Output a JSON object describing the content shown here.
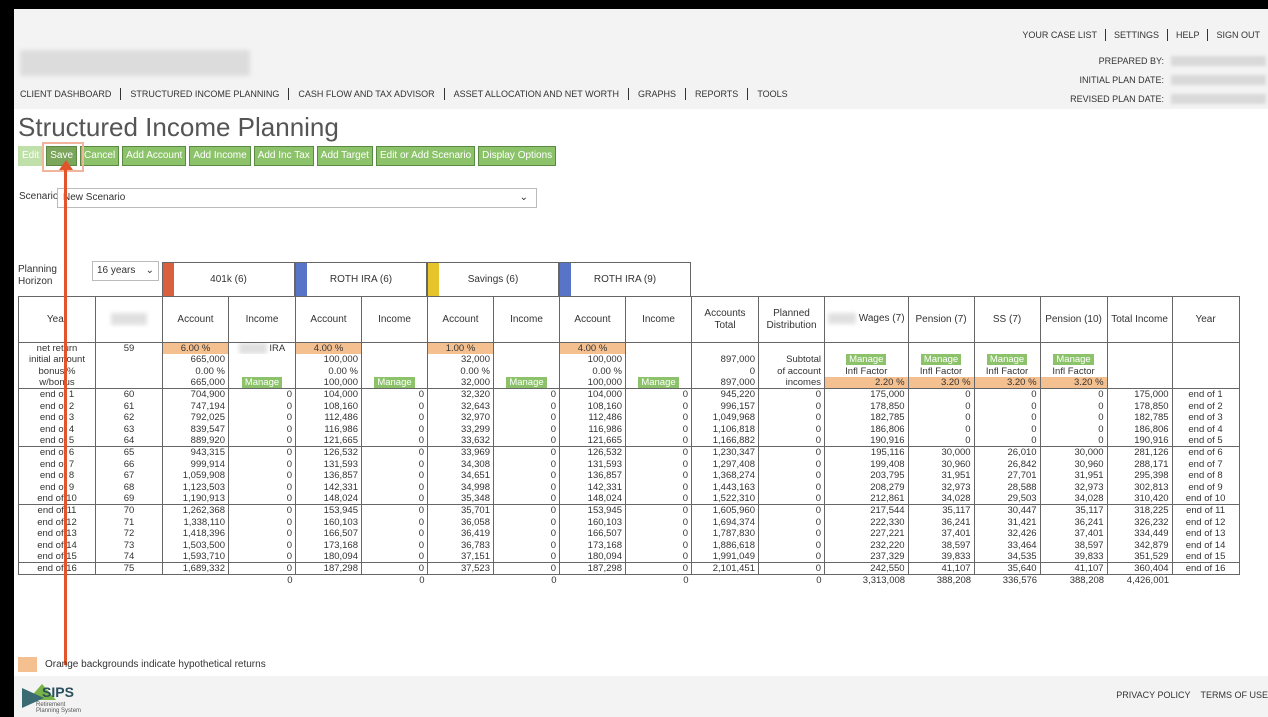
{
  "util_links": [
    "YOUR CASE LIST",
    "SETTINGS",
    "HELP",
    "SIGN OUT"
  ],
  "plan_info": {
    "prepared_by": "PREPARED BY:",
    "initial_plan_date": "INITIAL PLAN DATE:",
    "revised_plan_date": "REVISED PLAN DATE:"
  },
  "nav": [
    "CLIENT DASHBOARD",
    "STRUCTURED INCOME PLANNING",
    "CASH FLOW AND TAX ADVISOR",
    "ASSET ALLOCATION AND NET WORTH",
    "GRAPHS",
    "REPORTS",
    "TOOLS"
  ],
  "page_title": "Structured Income Planning",
  "toolbar": {
    "edit": "Edit",
    "save": "Save",
    "cancel": "Cancel",
    "add_account": "Add Account",
    "add_income": "Add Income",
    "add_inc_tax": "Add Inc Tax",
    "add_target": "Add Target",
    "edit_scenario": "Edit or Add Scenario",
    "display_options": "Display Options"
  },
  "scenario": {
    "label": "Scenario",
    "value": "New Scenario"
  },
  "planning_horizon": {
    "label_line1": "Planning",
    "label_line2": "Horizon",
    "value": "16 years"
  },
  "accounts": [
    {
      "name": "401k (6)",
      "color": "#d9603f"
    },
    {
      "name": "ROTH IRA (6)",
      "color": "#5874c9"
    },
    {
      "name": "Savings (6)",
      "color": "#e6c52b"
    },
    {
      "name": "ROTH IRA (9)",
      "color": "#5874c9"
    }
  ],
  "headers": {
    "year": "Year",
    "account": "Account",
    "income": "Income",
    "accounts_total": "Accounts Total",
    "planned_distribution": "Planned Distribution",
    "wages": "Wages (7)",
    "pension7": "Pension (7)",
    "ss": "SS (7)",
    "pension10": "Pension (10)",
    "total_income": "Total Income",
    "year_right": "Year"
  },
  "info_rows": {
    "labels": [
      "net return",
      "initial amount",
      "bonus %",
      "w/bonus"
    ],
    "age_first": "59",
    "a1": [
      "6.00 %",
      "665,000",
      "0.00 %",
      "665,000"
    ],
    "i1_ira": "IRA",
    "a2": [
      "4.00 %",
      "100,000",
      "0.00 %",
      "100,000"
    ],
    "a3": [
      "1.00 %",
      "32,000",
      "0.00 %",
      "32,000"
    ],
    "a4": [
      "4.00 %",
      "100,000",
      "0.00 %",
      "100,000"
    ],
    "accounts_total": [
      "",
      "897,000",
      "0",
      "897,000"
    ],
    "planned": [
      "",
      "Subtotal",
      "of account",
      "incomes"
    ],
    "manage": "Manage",
    "infl_factor": "Infl Factor",
    "wages_infl": "2.20 %",
    "p7_infl": "3.20 %",
    "ss_infl": "3.20 %",
    "p10_infl": "3.20 %"
  },
  "rows": [
    {
      "y": "end of 1",
      "age": "60",
      "a1": "704,900",
      "i1": "0",
      "a2": "104,000",
      "i2": "0",
      "a3": "32,320",
      "i3": "0",
      "a4": "104,000",
      "i4": "0",
      "tot": "945,220",
      "pd": "0",
      "w": "175,000",
      "p7": "0",
      "ss": "0",
      "p10": "0",
      "ti": "175,000"
    },
    {
      "y": "end of 2",
      "age": "61",
      "a1": "747,194",
      "i1": "0",
      "a2": "108,160",
      "i2": "0",
      "a3": "32,643",
      "i3": "0",
      "a4": "108,160",
      "i4": "0",
      "tot": "996,157",
      "pd": "0",
      "w": "178,850",
      "p7": "0",
      "ss": "0",
      "p10": "0",
      "ti": "178,850"
    },
    {
      "y": "end of 3",
      "age": "62",
      "a1": "792,025",
      "i1": "0",
      "a2": "112,486",
      "i2": "0",
      "a3": "32,970",
      "i3": "0",
      "a4": "112,486",
      "i4": "0",
      "tot": "1,049,968",
      "pd": "0",
      "w": "182,785",
      "p7": "0",
      "ss": "0",
      "p10": "0",
      "ti": "182,785"
    },
    {
      "y": "end of 4",
      "age": "63",
      "a1": "839,547",
      "i1": "0",
      "a2": "116,986",
      "i2": "0",
      "a3": "33,299",
      "i3": "0",
      "a4": "116,986",
      "i4": "0",
      "tot": "1,106,818",
      "pd": "0",
      "w": "186,806",
      "p7": "0",
      "ss": "0",
      "p10": "0",
      "ti": "186,806"
    },
    {
      "y": "end of 5",
      "age": "64",
      "a1": "889,920",
      "i1": "0",
      "a2": "121,665",
      "i2": "0",
      "a3": "33,632",
      "i3": "0",
      "a4": "121,665",
      "i4": "0",
      "tot": "1,166,882",
      "pd": "0",
      "w": "190,916",
      "p7": "0",
      "ss": "0",
      "p10": "0",
      "ti": "190,916"
    },
    {
      "y": "end of 6",
      "age": "65",
      "a1": "943,315",
      "i1": "0",
      "a2": "126,532",
      "i2": "0",
      "a3": "33,969",
      "i3": "0",
      "a4": "126,532",
      "i4": "0",
      "tot": "1,230,347",
      "pd": "0",
      "w": "195,116",
      "p7": "30,000",
      "ss": "26,010",
      "p10": "30,000",
      "ti": "281,126"
    },
    {
      "y": "end of 7",
      "age": "66",
      "a1": "999,914",
      "i1": "0",
      "a2": "131,593",
      "i2": "0",
      "a3": "34,308",
      "i3": "0",
      "a4": "131,593",
      "i4": "0",
      "tot": "1,297,408",
      "pd": "0",
      "w": "199,408",
      "p7": "30,960",
      "ss": "26,842",
      "p10": "30,960",
      "ti": "288,171"
    },
    {
      "y": "end of 8",
      "age": "67",
      "a1": "1,059,908",
      "i1": "0",
      "a2": "136,857",
      "i2": "0",
      "a3": "34,651",
      "i3": "0",
      "a4": "136,857",
      "i4": "0",
      "tot": "1,368,274",
      "pd": "0",
      "w": "203,795",
      "p7": "31,951",
      "ss": "27,701",
      "p10": "31,951",
      "ti": "295,398"
    },
    {
      "y": "end of 9",
      "age": "68",
      "a1": "1,123,503",
      "i1": "0",
      "a2": "142,331",
      "i2": "0",
      "a3": "34,998",
      "i3": "0",
      "a4": "142,331",
      "i4": "0",
      "tot": "1,443,163",
      "pd": "0",
      "w": "208,279",
      "p7": "32,973",
      "ss": "28,588",
      "p10": "32,973",
      "ti": "302,813"
    },
    {
      "y": "end of 10",
      "age": "69",
      "a1": "1,190,913",
      "i1": "0",
      "a2": "148,024",
      "i2": "0",
      "a3": "35,348",
      "i3": "0",
      "a4": "148,024",
      "i4": "0",
      "tot": "1,522,310",
      "pd": "0",
      "w": "212,861",
      "p7": "34,028",
      "ss": "29,503",
      "p10": "34,028",
      "ti": "310,420"
    },
    {
      "y": "end of 11",
      "age": "70",
      "a1": "1,262,368",
      "i1": "0",
      "a2": "153,945",
      "i2": "0",
      "a3": "35,701",
      "i3": "0",
      "a4": "153,945",
      "i4": "0",
      "tot": "1,605,960",
      "pd": "0",
      "w": "217,544",
      "p7": "35,117",
      "ss": "30,447",
      "p10": "35,117",
      "ti": "318,225"
    },
    {
      "y": "end of 12",
      "age": "71",
      "a1": "1,338,110",
      "i1": "0",
      "a2": "160,103",
      "i2": "0",
      "a3": "36,058",
      "i3": "0",
      "a4": "160,103",
      "i4": "0",
      "tot": "1,694,374",
      "pd": "0",
      "w": "222,330",
      "p7": "36,241",
      "ss": "31,421",
      "p10": "36,241",
      "ti": "326,232"
    },
    {
      "y": "end of 13",
      "age": "72",
      "a1": "1,418,396",
      "i1": "0",
      "a2": "166,507",
      "i2": "0",
      "a3": "36,419",
      "i3": "0",
      "a4": "166,507",
      "i4": "0",
      "tot": "1,787,830",
      "pd": "0",
      "w": "227,221",
      "p7": "37,401",
      "ss": "32,426",
      "p10": "37,401",
      "ti": "334,449"
    },
    {
      "y": "end of 14",
      "age": "73",
      "a1": "1,503,500",
      "i1": "0",
      "a2": "173,168",
      "i2": "0",
      "a3": "36,783",
      "i3": "0",
      "a4": "173,168",
      "i4": "0",
      "tot": "1,886,618",
      "pd": "0",
      "w": "232,220",
      "p7": "38,597",
      "ss": "33,464",
      "p10": "38,597",
      "ti": "342,879"
    },
    {
      "y": "end of 15",
      "age": "74",
      "a1": "1,593,710",
      "i1": "0",
      "a2": "180,094",
      "i2": "0",
      "a3": "37,151",
      "i3": "0",
      "a4": "180,094",
      "i4": "0",
      "tot": "1,991,049",
      "pd": "0",
      "w": "237,329",
      "p7": "39,833",
      "ss": "34,535",
      "p10": "39,833",
      "ti": "351,529"
    },
    {
      "y": "end of 16",
      "age": "75",
      "a1": "1,689,332",
      "i1": "0",
      "a2": "187,298",
      "i2": "0",
      "a3": "37,523",
      "i3": "0",
      "a4": "187,298",
      "i4": "0",
      "tot": "2,101,451",
      "pd": "0",
      "w": "242,550",
      "p7": "41,107",
      "ss": "35,640",
      "p10": "41,107",
      "ti": "360,404"
    }
  ],
  "totals": {
    "i1": "0",
    "i2": "0",
    "i3": "0",
    "i4": "0",
    "pd": "0",
    "w": "3,313,008",
    "p7": "388,208",
    "ss": "336,576",
    "p10": "388,208",
    "ti": "4,426,001"
  },
  "legend": "Orange backgrounds indicate hypothetical returns",
  "logo": {
    "name": "SIPS",
    "sub1": "Retirement",
    "sub2": "Planning System"
  },
  "footer_links": [
    "PRIVACY POLICY",
    "TERMS OF USE"
  ],
  "colors": {
    "button_green": "#8cc36a",
    "hypothetical_orange": "#f4c08f",
    "arrow_red": "#e2542a"
  }
}
